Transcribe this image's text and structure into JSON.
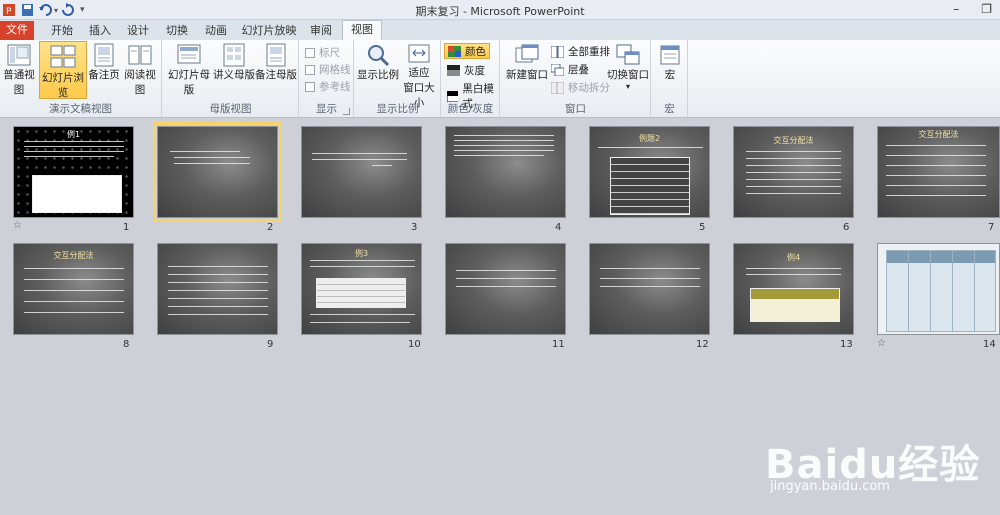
{
  "window": {
    "title": "期末复习 - Microsoft PowerPoint"
  },
  "tabs": [
    "文件",
    "开始",
    "插入",
    "设计",
    "切换",
    "动画",
    "幻灯片放映",
    "审阅",
    "视图"
  ],
  "active_tab": "视图",
  "ribbon": {
    "groups": {
      "presentation_views": {
        "label": "演示文稿视图",
        "buttons": [
          "普通视图",
          "幻灯片浏览",
          "备注页",
          "阅读视图"
        ],
        "selected": "幻灯片浏览"
      },
      "master_views": {
        "label": "母版视图",
        "buttons": [
          "幻灯片母版",
          "讲义母版",
          "备注母版"
        ]
      },
      "show": {
        "label": "显示",
        "items": [
          "标尺",
          "网格线",
          "参考线"
        ]
      },
      "zoom": {
        "label": "显示比例",
        "buttons": [
          "显示比例"
        ],
        "fit_line1": "适应",
        "fit_line2": "窗口大小"
      },
      "color": {
        "label": "颜色/灰度",
        "items": [
          "颜色",
          "灰度",
          "黑白模式"
        ]
      },
      "window": {
        "label": "窗口",
        "new_window": "新建窗口",
        "items": [
          "全部重排",
          "层叠",
          "移动拆分"
        ],
        "switch": "切换窗口"
      },
      "macro": {
        "label": "宏",
        "button": "宏"
      }
    }
  },
  "slides": [
    {
      "num": "1",
      "title": "例1"
    },
    {
      "num": "2"
    },
    {
      "num": "3"
    },
    {
      "num": "4"
    },
    {
      "num": "5",
      "title": "例题2"
    },
    {
      "num": "6",
      "title": "交互分配法"
    },
    {
      "num": "7",
      "title": "交互分配法"
    },
    {
      "num": "8",
      "title": "交互分配法"
    },
    {
      "num": "9"
    },
    {
      "num": "10",
      "title": "例3"
    },
    {
      "num": "11"
    },
    {
      "num": "12"
    },
    {
      "num": "13",
      "title": "例4"
    },
    {
      "num": "14"
    }
  ],
  "selected_slide": "2",
  "transition_marker": "☆",
  "watermark": {
    "brand": "Baidu经验",
    "url": "jingyan.baidu.com"
  }
}
